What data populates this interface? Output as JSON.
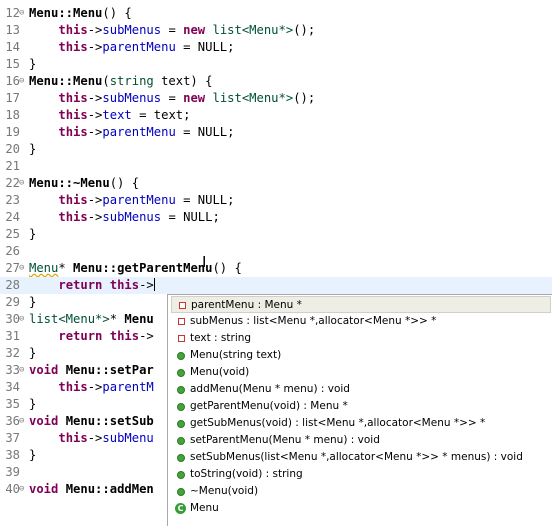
{
  "editor": {
    "lines": [
      {
        "n": "12",
        "fold": true,
        "segs": [
          {
            "t": "Menu::Menu",
            "c": "def"
          },
          {
            "t": "() {",
            "c": "txt"
          }
        ]
      },
      {
        "n": "13",
        "segs": [
          {
            "t": "    "
          },
          {
            "t": "this",
            "c": "kw"
          },
          {
            "t": "->",
            "c": "txt"
          },
          {
            "t": "subMenus",
            "c": "fld"
          },
          {
            "t": " = ",
            "c": "txt"
          },
          {
            "t": "new",
            "c": "kw"
          },
          {
            "t": " ",
            "c": "txt"
          },
          {
            "t": "list<Menu*>",
            "c": "typ"
          },
          {
            "t": "();",
            "c": "txt"
          }
        ]
      },
      {
        "n": "14",
        "segs": [
          {
            "t": "    "
          },
          {
            "t": "this",
            "c": "kw"
          },
          {
            "t": "->",
            "c": "txt"
          },
          {
            "t": "parentMenu",
            "c": "fld"
          },
          {
            "t": " = NULL;",
            "c": "txt"
          }
        ]
      },
      {
        "n": "15",
        "segs": [
          {
            "t": "}",
            "c": "txt"
          }
        ]
      },
      {
        "n": "16",
        "fold": true,
        "segs": [
          {
            "t": "Menu::Menu",
            "c": "def"
          },
          {
            "t": "(",
            "c": "txt"
          },
          {
            "t": "string",
            "c": "typ"
          },
          {
            "t": " text) {",
            "c": "txt"
          }
        ]
      },
      {
        "n": "17",
        "segs": [
          {
            "t": "    "
          },
          {
            "t": "this",
            "c": "kw"
          },
          {
            "t": "->",
            "c": "txt"
          },
          {
            "t": "subMenus",
            "c": "fld"
          },
          {
            "t": " = ",
            "c": "txt"
          },
          {
            "t": "new",
            "c": "kw"
          },
          {
            "t": " ",
            "c": "txt"
          },
          {
            "t": "list<Menu*>",
            "c": "typ"
          },
          {
            "t": "();",
            "c": "txt"
          }
        ]
      },
      {
        "n": "18",
        "segs": [
          {
            "t": "    "
          },
          {
            "t": "this",
            "c": "kw"
          },
          {
            "t": "->",
            "c": "txt"
          },
          {
            "t": "text",
            "c": "fld"
          },
          {
            "t": " = text;",
            "c": "txt"
          }
        ]
      },
      {
        "n": "19",
        "segs": [
          {
            "t": "    "
          },
          {
            "t": "this",
            "c": "kw"
          },
          {
            "t": "->",
            "c": "txt"
          },
          {
            "t": "parentMenu",
            "c": "fld"
          },
          {
            "t": " = NULL;",
            "c": "txt"
          }
        ]
      },
      {
        "n": "20",
        "segs": [
          {
            "t": "}",
            "c": "txt"
          }
        ]
      },
      {
        "n": "21",
        "segs": []
      },
      {
        "n": "22",
        "fold": true,
        "segs": [
          {
            "t": "Menu::~Menu",
            "c": "def"
          },
          {
            "t": "() {",
            "c": "txt"
          }
        ]
      },
      {
        "n": "23",
        "segs": [
          {
            "t": "    "
          },
          {
            "t": "this",
            "c": "kw"
          },
          {
            "t": "->",
            "c": "txt"
          },
          {
            "t": "parentMenu",
            "c": "fld"
          },
          {
            "t": " = NULL;",
            "c": "txt"
          }
        ]
      },
      {
        "n": "24",
        "segs": [
          {
            "t": "    "
          },
          {
            "t": "this",
            "c": "kw"
          },
          {
            "t": "->",
            "c": "txt"
          },
          {
            "t": "subMenus",
            "c": "fld"
          },
          {
            "t": " = NULL;",
            "c": "txt"
          }
        ]
      },
      {
        "n": "25",
        "segs": [
          {
            "t": "}",
            "c": "txt"
          }
        ]
      },
      {
        "n": "26",
        "segs": []
      },
      {
        "n": "27",
        "fold": true,
        "segs": [
          {
            "t": "Menu",
            "c": "typ",
            "warn": true
          },
          {
            "t": "* ",
            "c": "txt"
          },
          {
            "t": "Menu::getParentMenu",
            "c": "def"
          },
          {
            "t": "() {",
            "c": "txt"
          }
        ]
      },
      {
        "n": "28",
        "current": true,
        "segs": [
          {
            "t": "    "
          },
          {
            "t": "return",
            "c": "kw"
          },
          {
            "t": " ",
            "c": "txt"
          },
          {
            "t": "this",
            "c": "kw"
          },
          {
            "t": "->",
            "c": "txt"
          },
          {
            "caret": true
          }
        ]
      },
      {
        "n": "29",
        "segs": [
          {
            "t": "}",
            "c": "txt"
          }
        ]
      },
      {
        "n": "30",
        "fold": true,
        "segs": [
          {
            "t": "list<Menu*>",
            "c": "typ"
          },
          {
            "t": "* ",
            "c": "txt"
          },
          {
            "t": "Menu",
            "c": "def"
          }
        ]
      },
      {
        "n": "31",
        "segs": [
          {
            "t": "    "
          },
          {
            "t": "return",
            "c": "kw"
          },
          {
            "t": " ",
            "c": "txt"
          },
          {
            "t": "this",
            "c": "kw"
          },
          {
            "t": "->",
            "c": "txt"
          }
        ]
      },
      {
        "n": "32",
        "segs": [
          {
            "t": "}",
            "c": "txt"
          }
        ]
      },
      {
        "n": "33",
        "fold": true,
        "segs": [
          {
            "t": "void",
            "c": "kw"
          },
          {
            "t": " ",
            "c": "txt"
          },
          {
            "t": "Menu::setPar",
            "c": "def"
          }
        ]
      },
      {
        "n": "34",
        "segs": [
          {
            "t": "    "
          },
          {
            "t": "this",
            "c": "kw"
          },
          {
            "t": "->",
            "c": "txt"
          },
          {
            "t": "parentM",
            "c": "fld"
          }
        ]
      },
      {
        "n": "35",
        "segs": [
          {
            "t": "}",
            "c": "txt"
          }
        ]
      },
      {
        "n": "36",
        "fold": true,
        "segs": [
          {
            "t": "void",
            "c": "kw"
          },
          {
            "t": " ",
            "c": "txt"
          },
          {
            "t": "Menu::setSub",
            "c": "def"
          }
        ]
      },
      {
        "n": "37",
        "segs": [
          {
            "t": "    "
          },
          {
            "t": "this",
            "c": "kw"
          },
          {
            "t": "->",
            "c": "txt"
          },
          {
            "t": "subMenu",
            "c": "fld"
          }
        ]
      },
      {
        "n": "38",
        "segs": [
          {
            "t": "}",
            "c": "txt"
          }
        ]
      },
      {
        "n": "39",
        "segs": []
      },
      {
        "n": "40",
        "fold": true,
        "segs": [
          {
            "t": "void",
            "c": "kw"
          },
          {
            "t": " ",
            "c": "txt"
          },
          {
            "t": "Menu::addMen",
            "c": "def"
          }
        ]
      }
    ]
  },
  "autocomplete": {
    "items": [
      {
        "icon": "field-icon",
        "label": "parentMenu : Menu *",
        "selected": true
      },
      {
        "icon": "field-icon",
        "label": "subMenus : list<Menu *,allocator<Menu *>> *"
      },
      {
        "icon": "field-icon",
        "label": "text : string"
      },
      {
        "icon": "method-icon",
        "label": "Menu(string text)"
      },
      {
        "icon": "method-icon",
        "label": "Menu(void)"
      },
      {
        "icon": "method-icon",
        "label": "addMenu(Menu * menu) : void"
      },
      {
        "icon": "method-icon",
        "label": "getParentMenu(void) : Menu *"
      },
      {
        "icon": "method-icon",
        "label": "getSubMenus(void) : list<Menu *,allocator<Menu *>> *"
      },
      {
        "icon": "method-icon",
        "label": "setParentMenu(Menu * menu) : void"
      },
      {
        "icon": "method-icon",
        "label": "setSubMenus(list<Menu *,allocator<Menu *>> * menus) : void"
      },
      {
        "icon": "method-icon",
        "label": "toString(void) : string"
      },
      {
        "icon": "method-icon",
        "label": "~Menu(void)"
      },
      {
        "icon": "class-icon",
        "label": "Menu"
      }
    ]
  }
}
